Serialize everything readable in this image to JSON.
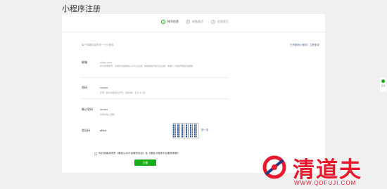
{
  "page": {
    "title": "小程序注册"
  },
  "steps": [
    {
      "num": "1",
      "label": "帐号信息",
      "active": true
    },
    {
      "num": "2",
      "label": "邮箱激活",
      "active": false
    },
    {
      "num": "3",
      "label": "信息登记",
      "active": false
    }
  ],
  "form": {
    "head_note": "每个邮箱仅能申请一个小程序",
    "head_right": "已有微信小程序？立即登录",
    "email": {
      "label": "邮箱",
      "value": "作为登录帐号，请填写未被微信公众平台注册，未被微信开放平台注册，未被个人微信号绑定的邮箱",
      "placeholder": "@qq.com"
    },
    "password": {
      "label": "密码",
      "value": "••••••••",
      "hint": "字母、数字或者英文符号，最短8位，区分大小写"
    },
    "confirm": {
      "label": "确认密码",
      "value": "••••••••",
      "hint": "请再次输入密码"
    },
    "captcha": {
      "label": "验证码",
      "value": "aBcd",
      "refresh": "换一张"
    },
    "agree": "你已阅读并同意《微信公众平台服务协议》及《微信小程序平台服务条款》",
    "submit": "注册"
  },
  "side_tool": {
    "label": "反馈"
  },
  "watermark": {
    "text": "清道夫",
    "url": "WWW.QDFUJI.COM"
  },
  "colors": {
    "accent": "#1aad19",
    "link": "#576b95",
    "watermark": "#e8192c"
  }
}
